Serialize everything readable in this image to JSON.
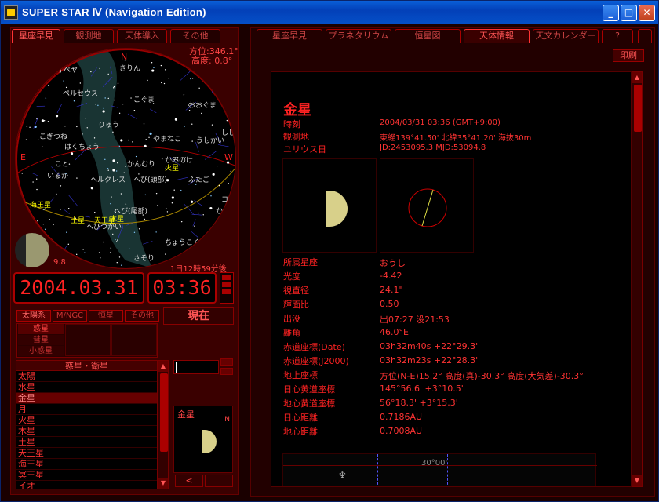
{
  "window": {
    "title": "SUPER STAR Ⅳ (Navigation Edition)",
    "min": "_",
    "max": "□",
    "close": "✕"
  },
  "left_tabs": [
    "星座早見",
    "観測地",
    "天体導入",
    "その他"
  ],
  "right_tabs": [
    "星座早見",
    "プラネタリウム",
    "恒星図",
    "天体情報",
    "天文カレンダー",
    "?",
    ""
  ],
  "print_label": "印刷",
  "sky": {
    "azimuth": "方位:346.1°",
    "altitude": "高度: 0.8°",
    "north": "N",
    "east": "E",
    "west": "W",
    "labels": [
      "カシオペヤ",
      "こぐま",
      "きりん",
      "ペルセウス",
      "りゅう",
      "おおぐま",
      "こぎつね",
      "はくちょう",
      "やまねこ",
      "いるか",
      "ヘルクレス",
      "へび(頭部)",
      "かんむり",
      "うしかい",
      "こと",
      "かみのけ",
      "しし",
      "へび(尾部)",
      "へびつかい",
      "ふたご",
      "からす",
      "さそり",
      "コップ",
      "ちょうこくしつ",
      "海王星",
      "天王星",
      "木星",
      "土星",
      "火星"
    ]
  },
  "moon_age": "9.8",
  "elapsed": "1日12時59分後",
  "date": {
    "y": "2004",
    "m": "03",
    "d": "31"
  },
  "time": {
    "h": "03",
    "m": "36"
  },
  "now_label": "現在",
  "object_tabs": [
    "太陽系",
    "M/NGC",
    "恒星",
    "その他"
  ],
  "object_sub": [
    "惑星",
    "彗星",
    "小惑星"
  ],
  "planets": {
    "header": "惑星・衛星",
    "items": [
      "太陽",
      "水星",
      "金星",
      "月",
      "火星",
      "木星",
      "土星",
      "天王星",
      "海王星",
      "冥王星",
      "イオ"
    ],
    "selected": "金星"
  },
  "mini": {
    "name": "金星",
    "compass_n": "N",
    "prev": "<"
  },
  "info": {
    "title": "金星",
    "rows": [
      {
        "label": "時刻",
        "value": "2004/03/31 03:36 (GMT+9:00)"
      },
      {
        "label": "観測地",
        "value": "東経139°41.50' 北緯35°41.20' 海抜30m"
      },
      {
        "label": "ユリウス日",
        "value": "JD:2453095.3 MJD:53094.8"
      }
    ],
    "rows2": [
      {
        "label": "所属星座",
        "value": "おうし"
      },
      {
        "label": "光度",
        "value": "-4.42"
      },
      {
        "label": "視直径",
        "value": "24.1\""
      },
      {
        "label": "輝面比",
        "value": "0.50"
      },
      {
        "label": "出没",
        "value": "出07:27 没21:53"
      },
      {
        "label": "離角",
        "value": "46.0°E"
      },
      {
        "label": "赤道座標(Date)",
        "value": "03h32m40s +22°29.3'"
      },
      {
        "label": "赤道座標(J2000)",
        "value": "03h32m23s +22°28.3'"
      },
      {
        "label": "地上座標",
        "value": "方位(N-E)15.2° 高度(真)-30.3° 高度(大気差)-30.3°"
      },
      {
        "label": "日心黄道座標",
        "value": "145°56.6' +3°10.5'"
      },
      {
        "label": "地心黄道座標",
        "value": "56°18.3' +3°15.3'"
      },
      {
        "label": "日心距離",
        "value": "0.7186AU"
      },
      {
        "label": "地心距離",
        "value": "0.7008AU"
      }
    ],
    "strip_label": "30°00'",
    "strip_symbol": "♆"
  },
  "colors": {
    "accent": "#ff2222",
    "panel": "#3a0000",
    "venus": "#d8d08a"
  }
}
